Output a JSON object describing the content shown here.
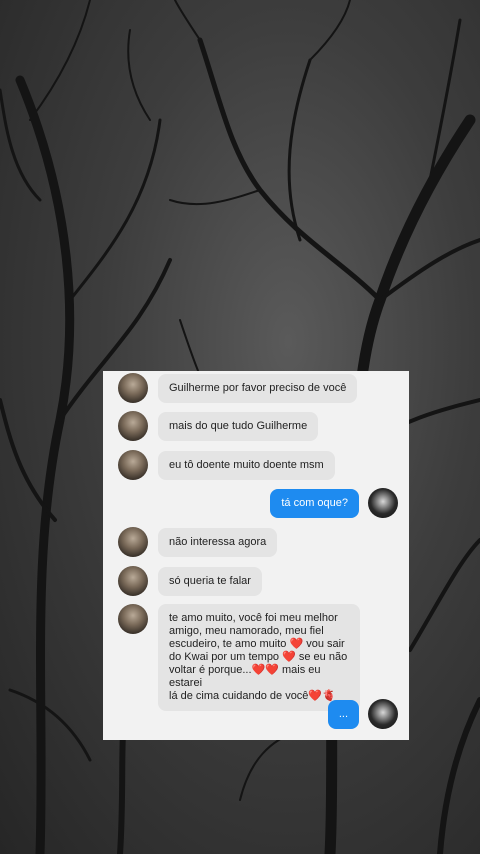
{
  "chat": {
    "messages": [
      {
        "from": "them",
        "text": "Guilherme por favor preciso de você"
      },
      {
        "from": "them",
        "text": "mais do que tudo Guilherme"
      },
      {
        "from": "them",
        "text": "eu tô doente muito doente msm"
      },
      {
        "from": "me",
        "text": "tá com oque?"
      },
      {
        "from": "them",
        "text": "não interessa agora"
      },
      {
        "from": "them",
        "text": "só queria te falar"
      },
      {
        "from": "them",
        "text": "te amo muito, você foi meu melhor\namigo, meu namorado, meu fiel\nescudeiro, te amo muito ❤️ vou sair\ndo Kwai por um tempo ❤️ se eu não\nvoltar é porque...❤️❤️ mais eu estarei\nlá de cima cuidando de você❤️🫀"
      },
      {
        "from": "me",
        "text": "..."
      }
    ]
  },
  "colors": {
    "outgoing_bubble": "#1e8bf0",
    "incoming_bubble": "#e4e4e4",
    "card_background": "#f2f2f2"
  }
}
